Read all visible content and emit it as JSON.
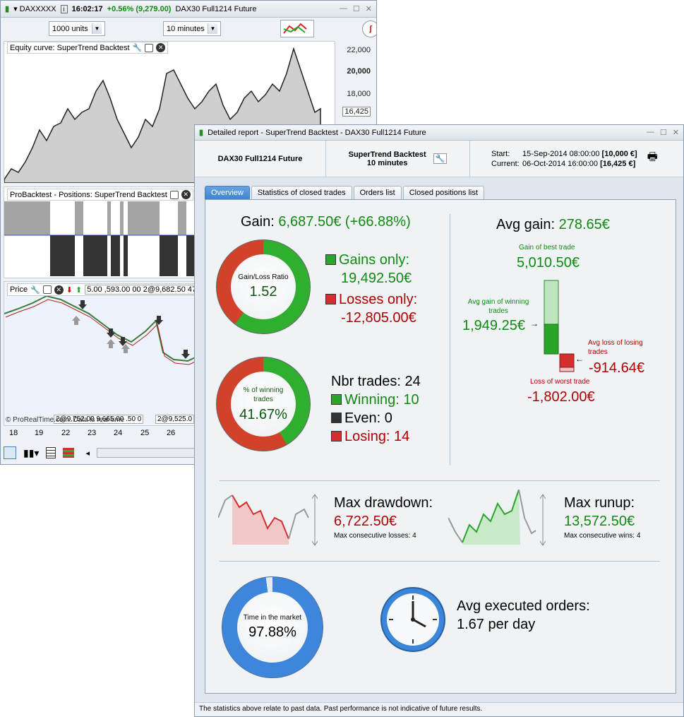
{
  "back": {
    "symbol": "DAXXXXX",
    "time": "16:02:17",
    "change": "+0.56% (9,279.00)",
    "instrument": "DAX30  Full1214 Future",
    "units_select": "1000 units",
    "interval_select": "10 minutes",
    "equity_label": "Equity curve: SuperTrend Backtest",
    "equity_axis": [
      "22,000",
      "20,000",
      "18,000",
      "16,425"
    ],
    "positions_label": "ProBacktest - Positions: SuperTrend Backtest",
    "price_label": "Price",
    "price_readout": "5.00 ,593.00 00 2@9,682.50 479",
    "order_text_1": "2@9,752.00 9,665.00 .50 0",
    "order_text_2": "2@9,525.0",
    "watermark": "© ProRealTime.com. Data is real-time",
    "dates": [
      "18",
      "19",
      "22",
      "23",
      "24",
      "25",
      "26"
    ]
  },
  "front": {
    "title": "Detailed report - SuperTrend Backtest - DAX30  Full1214 Future",
    "header": {
      "instrument": "DAX30  Full1214 Future",
      "strategy": "SuperTrend Backtest",
      "interval": "10 minutes",
      "start_label": "Start:",
      "start_date": "15-Sep-2014 08:00:00",
      "start_cap": "[10,000 €]",
      "current_label": "Current:",
      "current_date": "06-Oct-2014 16:00:00",
      "current_cap": "[16,425 €]"
    },
    "tabs": [
      "Overview",
      "Statistics of closed trades",
      "Orders list",
      "Closed positions list"
    ],
    "gain_label": "Gain:",
    "gain_value": "6,687.50€ (+66.88%)",
    "ratio_label": "Gain/Loss Ratio",
    "ratio_value": "1.52",
    "gains_only_label": "Gains only:",
    "gains_only_value": "19,492.50€",
    "losses_only_label": "Losses only:",
    "losses_only_value": "-12,805.00€",
    "winpct_label": "% of winning trades",
    "winpct_value": "41.67%",
    "nbr_trades": "Nbr trades: 24",
    "winning": "Winning: 10",
    "even": "Even: 0",
    "losing": "Losing: 14",
    "avg_gain_label": "Avg gain:",
    "avg_gain_value": "278.65€",
    "best_label": "Gain of best trade",
    "best_value": "5,010.50€",
    "avg_win_label": "Avg gain of winning trades",
    "avg_win_value": "1,949.25€",
    "avg_loss_label": "Avg loss of losing trades",
    "avg_loss_value": "-914.64€",
    "worst_label": "Loss of worst trade",
    "worst_value": "-1,802.00€",
    "max_dd_label": "Max drawdown:",
    "max_dd_value": "6,722.50€",
    "max_cons_losses": "Max consecutive losses: 4",
    "max_ru_label": "Max runup:",
    "max_ru_value": "13,572.50€",
    "max_cons_wins": "Max consecutive wins: 4",
    "time_label": "Time in the market",
    "time_value": "97.88%",
    "time_fraction": 0.9788,
    "win_fraction": 0.4167,
    "ratio_gain_share": 0.6035,
    "avg_orders_label": "Avg executed orders:",
    "avg_orders_value": "1.67 per day",
    "footer": "The statistics above relate to past data. Past performance is not indicative of future results."
  }
}
